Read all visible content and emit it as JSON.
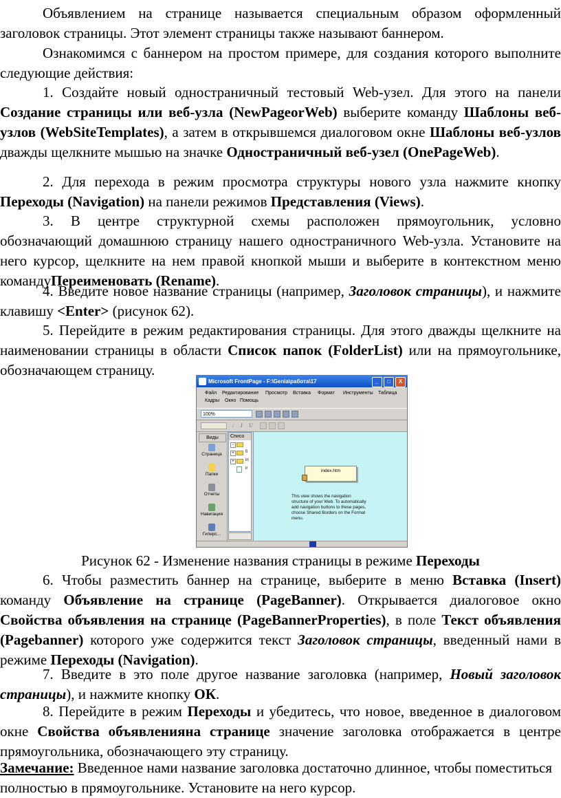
{
  "paragraphs": {
    "p1": "Объявлением на странице называется специальным образом оформленный заголовок страницы. Этот элемент страницы также называют баннером.",
    "p2": "Ознакомимся с баннером на простом примере, для создания которого выполните следующие действия:",
    "p3": {
      "t1": "1. Создайте новый одностраничный тестовый Web-узел. Для этого на панели ",
      "b1": "Создание страницы или веб-узла (NewPageorWeb)",
      "t2": " выберите команду ",
      "b2": "Шаблоны веб-узлов (WebSiteTemplates)",
      "t3": ", а затем в открывшемся диалоговом окне ",
      "b3": "Шаблоны веб-узлов",
      "t4": " дважды щелкните мышью на значке ",
      "b4": "Одностраничный веб-узел (OnePageWeb)",
      "t5": "."
    },
    "p4": {
      "t1": "2. Для перехода в режим просмотра структуры нового узла нажмите кнопку ",
      "b1": "Переходы (Navigation)",
      "t2": " на панели режимов ",
      "b2": "Представления (Views)",
      "t3": "."
    },
    "p5": {
      "t1": "3. В центре структурной схемы расположен прямоугольник, условно обозначающий домашнюю страницу нашего одностраничного Web-узла. Установите на него курсор, щелкните на нем правой кнопкой мыши и выберите в контекстном меню команду",
      "b1": "Переименовать (Rename)",
      "t2": "."
    },
    "p6": {
      "t1": "4. Введите новое название страницы (например, ",
      "bi1": "Заголовок страницы",
      "t2": "), и нажмите клавишу ",
      "b1": "<Enter>",
      "t3": " (рисунок 62)."
    },
    "p7": {
      "t1": "5. Перейдите в режим редактирования страницы. Для этого дважды щелкните на наименовании страницы в области ",
      "b1": "Список папок (FolderList)",
      "t2": " или на прямоугольнике, обозначающем страницу."
    },
    "caption": {
      "t1": "Рисунок 62 - Изменение названия страницы в режиме ",
      "b1": "Переходы"
    },
    "p8": {
      "t1": "6. Чтобы разместить баннер на странице, выберите в меню ",
      "b1": "Вставка (Insert)",
      "t2": " команду ",
      "b2": "Объявление на странице (PageBanner)",
      "t3": ". Открывается диалоговое окно ",
      "b3": "Свойства объявления на странице (PageBannerProperties)",
      "t4": ", в поле ",
      "b4": "Текст объявления (Pagebanner)",
      "t5": " которого уже содержится текст ",
      "bi1": "Заголовок страницы",
      "t6": ", введенный нами в режиме ",
      "b5": "Переходы (Navigation)",
      "t7": "."
    },
    "p9": {
      "t1": "7. Введите в это поле другое название заголовка (например, ",
      "bi1": "Новый заголовок страницы",
      "t2": "), и нажмите кнопку ",
      "b1": "ОК",
      "t3": "."
    },
    "p10": {
      "t1": "8. Перейдите в режим ",
      "b1": "Переходы",
      "t2": " и убедитесь, что новое, введенное в диалоговом окне ",
      "b2": "Свойства объявленияна странице",
      "t3": " значение заголовка отображается в центре прямоугольника, обозначающего эту страницу."
    },
    "note": {
      "label": "Замечание:",
      "t1": " Введенное нами название заголовка достаточно длинное, чтобы поместиться полностью в прямоугольнике. Установите на него курсор."
    }
  },
  "figure": {
    "window_title": "Microsoft FrontPage - F:\\Genia\\работа\\17",
    "window_buttons": [
      "_",
      "□",
      "X"
    ],
    "menu": [
      "Файл",
      "Редактирование",
      "Просмотр",
      "Вставка",
      "Формат",
      "Инструменты",
      "Таблица",
      "Кадры",
      "Окно",
      "Помощь"
    ],
    "zoom": "100%",
    "views_header": "Виды",
    "views": [
      "Страница",
      "Папки",
      "Отчеты",
      "Навигация",
      "Гиперс..."
    ],
    "folder_header": "Списо",
    "folder_rows": [
      "",
      "fi",
      "in",
      "ir"
    ],
    "page_box_label": "index.htm",
    "nav_note": "This view shows the navigation structure of your Web. To automatically add navigation buttons to these pages, choose Shared Borders on the Format menu."
  }
}
